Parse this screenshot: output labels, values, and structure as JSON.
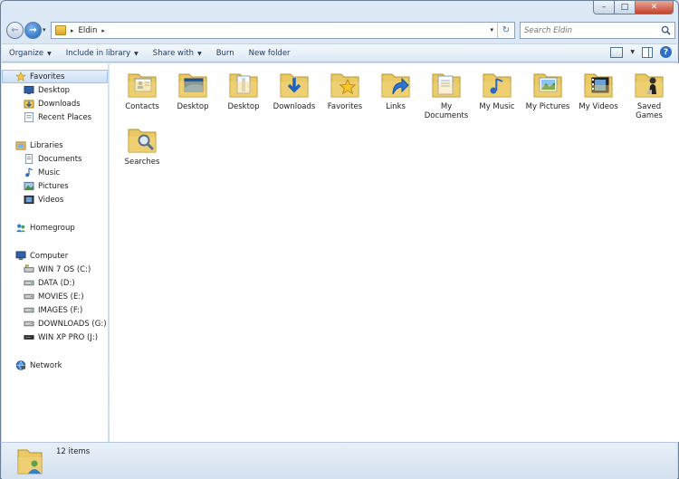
{
  "window": {
    "minimize": "–",
    "maximize": "□",
    "close": "✕"
  },
  "nav": {
    "back": "←",
    "forward": "→",
    "history_dropdown": "▾"
  },
  "address": {
    "path": "Eldin",
    "refresh": "↻"
  },
  "search": {
    "placeholder": "Search Eldin"
  },
  "toolbar": {
    "organize": "Organize",
    "include_in_library": "Include in library",
    "share_with": "Share with",
    "burn": "Burn",
    "new_folder": "New folder",
    "help": "?"
  },
  "sidebar": {
    "favorites": "Favorites",
    "favorites_items": [
      "Desktop",
      "Downloads",
      "Recent Places"
    ],
    "libraries": "Libraries",
    "libraries_items": [
      "Documents",
      "Music",
      "Pictures",
      "Videos"
    ],
    "homegroup": "Homegroup",
    "computer": "Computer",
    "computer_items": [
      "WIN 7 OS (C:)",
      "DATA (D:)",
      "MOVIES (E:)",
      "IMAGES (F:)",
      "DOWNLOADS (G:)",
      "WIN XP PRO (J:)"
    ],
    "network": "Network"
  },
  "files": [
    {
      "label": "Contacts",
      "icon": "contacts-folder-icon"
    },
    {
      "label": "Desktop",
      "icon": "desktop-folder-icon"
    },
    {
      "label": "Desktop",
      "icon": "desktop-shortcut-folder-icon"
    },
    {
      "label": "Downloads",
      "icon": "downloads-folder-icon"
    },
    {
      "label": "Favorites",
      "icon": "favorites-folder-icon"
    },
    {
      "label": "Links",
      "icon": "links-folder-icon"
    },
    {
      "label": "My Documents",
      "icon": "documents-folder-icon"
    },
    {
      "label": "My Music",
      "icon": "music-folder-icon"
    },
    {
      "label": "My Pictures",
      "icon": "pictures-folder-icon"
    },
    {
      "label": "My Videos",
      "icon": "videos-folder-icon"
    },
    {
      "label": "Saved Games",
      "icon": "saved-games-folder-icon"
    },
    {
      "label": "Searches",
      "icon": "searches-folder-icon"
    }
  ],
  "status": {
    "count": "12 items"
  }
}
